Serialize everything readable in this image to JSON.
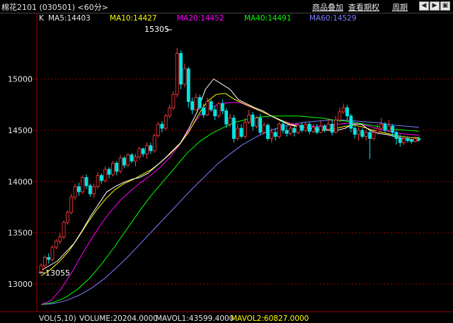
{
  "header": {
    "title": "棉花2101 (030501) <60分>",
    "links": [
      "商品叠加",
      "查看期权",
      "周期"
    ]
  },
  "legend": {
    "k": "K",
    "ma5": "MA5:14403",
    "ma10": "MA10:14427",
    "ma20": "MA20:14452",
    "ma40": "MA40:14491",
    "ma60": "MA60:14529"
  },
  "annotations": {
    "high": "15305",
    "low": "13055"
  },
  "volume_legend": {
    "vol": "VOL(5,10)",
    "volume": "VOLUME:20204.0000",
    "mavol1": "MAVOL1:43599.4000",
    "mavol2": "MAVOL2:60827.0000"
  },
  "colors": {
    "background": "#000000",
    "up": "#ff3d3d",
    "down": "#00e5e5",
    "grid": "#9b0000",
    "ma5": "#ffffff",
    "ma10": "#ffff00",
    "ma20": "#ff00ff",
    "ma40": "#00ff00",
    "ma60": "#7b7bff"
  },
  "chart_data": {
    "type": "candlestick",
    "y_ticks": [
      "15000",
      "14500",
      "14000",
      "13500",
      "13000"
    ],
    "ylim": [
      12800,
      15550
    ],
    "candles": [
      [
        13120,
        13180,
        13100,
        13200
      ],
      [
        13180,
        13260,
        13150,
        13280
      ],
      [
        13260,
        13240,
        13200,
        13300
      ],
      [
        13240,
        13360,
        13220,
        13380
      ],
      [
        13360,
        13420,
        13340,
        13440
      ],
      [
        13420,
        13460,
        13390,
        13500
      ],
      [
        13460,
        13600,
        13440,
        13620
      ],
      [
        13600,
        13700,
        13580,
        13720
      ],
      [
        13700,
        13850,
        13680,
        13880
      ],
      [
        13850,
        13950,
        13820,
        13980
      ],
      [
        13950,
        13900,
        13860,
        13990
      ],
      [
        13900,
        14040,
        13880,
        14060
      ],
      [
        14040,
        13960,
        13930,
        14070
      ],
      [
        13960,
        13880,
        13850,
        13980
      ],
      [
        13880,
        13950,
        13840,
        13980
      ],
      [
        13950,
        14060,
        13930,
        14090
      ],
      [
        14060,
        14010,
        13980,
        14080
      ],
      [
        14010,
        14120,
        13990,
        14150
      ],
      [
        14120,
        14070,
        14030,
        14140
      ],
      [
        14070,
        14180,
        14050,
        14200
      ],
      [
        14180,
        14100,
        14060,
        14200
      ],
      [
        14100,
        14230,
        14080,
        14260
      ],
      [
        14230,
        14160,
        14130,
        14250
      ],
      [
        14160,
        14260,
        14140,
        14280
      ],
      [
        14260,
        14200,
        14180,
        14280
      ],
      [
        14200,
        14240,
        14150,
        14270
      ],
      [
        14240,
        14320,
        14220,
        14340
      ],
      [
        14320,
        14270,
        14240,
        14330
      ],
      [
        14270,
        14350,
        14220,
        14380
      ],
      [
        14350,
        14300,
        14270,
        14380
      ],
      [
        14300,
        14450,
        14280,
        14470
      ],
      [
        14450,
        14560,
        14430,
        14580
      ],
      [
        14560,
        14520,
        14480,
        14590
      ],
      [
        14520,
        14640,
        14500,
        14660
      ],
      [
        14640,
        14720,
        14620,
        14750
      ],
      [
        14720,
        14850,
        14700,
        14880
      ],
      [
        14850,
        15250,
        14820,
        15305
      ],
      [
        15250,
        14950,
        14900,
        15280
      ],
      [
        14950,
        15100,
        14920,
        15150
      ],
      [
        15100,
        14780,
        14720,
        15120
      ],
      [
        14780,
        14700,
        14660,
        14820
      ],
      [
        14700,
        14820,
        14690,
        14860
      ],
      [
        14820,
        14720,
        14700,
        14850
      ],
      [
        14720,
        14650,
        14620,
        14760
      ],
      [
        14650,
        14780,
        14640,
        14820
      ],
      [
        14780,
        14700,
        14680,
        14800
      ],
      [
        14700,
        14640,
        14600,
        14740
      ],
      [
        14640,
        14760,
        14620,
        14780
      ],
      [
        14760,
        14690,
        14660,
        14800
      ],
      [
        14690,
        14560,
        14520,
        14720
      ],
      [
        14560,
        14620,
        14530,
        14660
      ],
      [
        14620,
        14420,
        14380,
        14650
      ],
      [
        14420,
        14520,
        14400,
        14560
      ],
      [
        14520,
        14440,
        14420,
        14560
      ],
      [
        14440,
        14580,
        14420,
        14620
      ],
      [
        14580,
        14650,
        14560,
        14700
      ],
      [
        14650,
        14540,
        14500,
        14680
      ],
      [
        14540,
        14620,
        14520,
        14640
      ],
      [
        14620,
        14480,
        14460,
        14660
      ],
      [
        14480,
        14550,
        14460,
        14580
      ],
      [
        14550,
        14420,
        14400,
        14570
      ],
      [
        14420,
        14480,
        14380,
        14520
      ],
      [
        14480,
        14440,
        14400,
        14520
      ],
      [
        14440,
        14560,
        14420,
        14580
      ],
      [
        14560,
        14500,
        14470,
        14600
      ],
      [
        14500,
        14470,
        14440,
        14540
      ],
      [
        14470,
        14520,
        14450,
        14560
      ],
      [
        14520,
        14480,
        14440,
        14540
      ],
      [
        14480,
        14550,
        14460,
        14570
      ],
      [
        14550,
        14500,
        14480,
        14580
      ],
      [
        14500,
        14560,
        14480,
        14580
      ],
      [
        14560,
        14490,
        14460,
        14580
      ],
      [
        14490,
        14530,
        14470,
        14560
      ],
      [
        14530,
        14480,
        14460,
        14560
      ],
      [
        14480,
        14540,
        14470,
        14590
      ],
      [
        14540,
        14510,
        14480,
        14560
      ],
      [
        14510,
        14560,
        14490,
        14620
      ],
      [
        14560,
        14480,
        14450,
        14600
      ],
      [
        14480,
        14600,
        14470,
        14640
      ],
      [
        14600,
        14680,
        14580,
        14720
      ],
      [
        14680,
        14720,
        14660,
        14760
      ],
      [
        14720,
        14640,
        14600,
        14750
      ],
      [
        14640,
        14520,
        14480,
        14660
      ],
      [
        14520,
        14460,
        14420,
        14540
      ],
      [
        14460,
        14500,
        14400,
        14530
      ],
      [
        14500,
        14440,
        14420,
        14520
      ],
      [
        14440,
        14480,
        14400,
        14500
      ],
      [
        14480,
        14420,
        14220,
        14500
      ],
      [
        14420,
        14480,
        14400,
        14520
      ],
      [
        14480,
        14520,
        14460,
        14560
      ],
      [
        14520,
        14560,
        14500,
        14620
      ],
      [
        14560,
        14500,
        14480,
        14580
      ],
      [
        14500,
        14540,
        14480,
        14600
      ],
      [
        14540,
        14480,
        14440,
        14560
      ],
      [
        14480,
        14420,
        14360,
        14500
      ],
      [
        14420,
        14380,
        14340,
        14460
      ],
      [
        14380,
        14420,
        14360,
        14450
      ],
      [
        14420,
        14400,
        14380,
        14440
      ],
      [
        14400,
        14390,
        14370,
        14420
      ],
      [
        14390,
        14420,
        14380,
        14440
      ],
      [
        14420,
        14410,
        14390,
        14440
      ]
    ],
    "ma5": [
      13130,
      13180,
      13225,
      13310,
      13395,
      13520,
      13660,
      13780,
      13900,
      13950,
      13990,
      14020,
      14040,
      14080,
      14150,
      14220,
      14300,
      14380,
      14520,
      14680,
      14900,
      15000,
      14950,
      14900,
      14800,
      14760,
      14720,
      14690,
      14640,
      14600,
      14560,
      14540,
      14530,
      14520,
      14500,
      14500,
      14500,
      14520,
      14560,
      14560,
      14500,
      14470,
      14460,
      14440,
      14420,
      14410,
      14400
    ],
    "ma10": [
      13080,
      13140,
      13220,
      13320,
      13450,
      13590,
      13720,
      13830,
      13920,
      13980,
      14020,
      14070,
      14120,
      14190,
      14270,
      14360,
      14480,
      14640,
      14780,
      14850,
      14860,
      14800,
      14760,
      14720,
      14680,
      14640,
      14600,
      14560,
      14540,
      14520,
      14510,
      14510,
      14520,
      14540,
      14550,
      14530,
      14500,
      14480,
      14460,
      14440,
      14430,
      14427
    ],
    "ma20": [
      12800,
      12840,
      12950,
      13100,
      13270,
      13430,
      13580,
      13710,
      13820,
      13910,
      13990,
      14060,
      14140,
      14240,
      14370,
      14520,
      14650,
      14720,
      14760,
      14770,
      14770,
      14730,
      14690,
      14650,
      14600,
      14570,
      14550,
      14540,
      14540,
      14550,
      14560,
      14570,
      14560,
      14540,
      14510,
      14490,
      14470,
      14460,
      14452
    ],
    "ma40": [
      12800,
      12820,
      12870,
      12950,
      13060,
      13200,
      13360,
      13530,
      13700,
      13860,
      14000,
      14140,
      14280,
      14390,
      14470,
      14530,
      14580,
      14610,
      14630,
      14640,
      14640,
      14640,
      14630,
      14620,
      14600,
      14590,
      14570,
      14550,
      14530,
      14510,
      14500,
      14491
    ],
    "ma60": [
      12800,
      12810,
      12840,
      12890,
      12960,
      13050,
      13160,
      13280,
      13410,
      13540,
      13670,
      13800,
      13930,
      14050,
      14170,
      14270,
      14360,
      14430,
      14490,
      14530,
      14560,
      14580,
      14590,
      14600,
      14600,
      14590,
      14580,
      14570,
      14550,
      14540,
      14529
    ]
  }
}
